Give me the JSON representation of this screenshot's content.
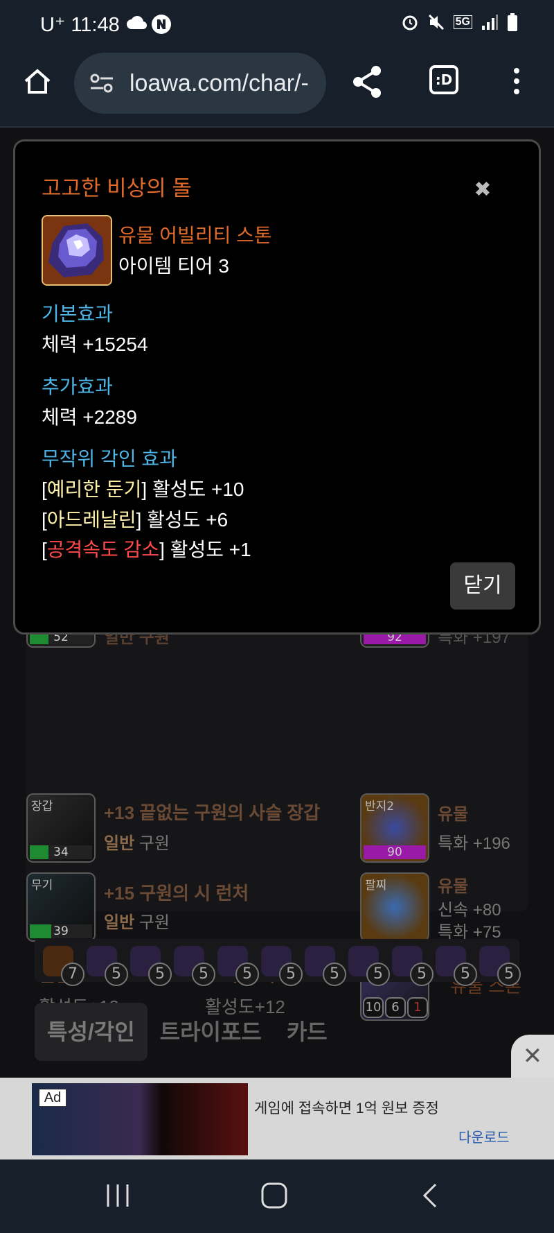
{
  "status": {
    "carrier": "U⁺",
    "time": "11:48",
    "network": "5G"
  },
  "browser": {
    "url": "loawa.com/char/-",
    "tab_label": ":D"
  },
  "background": {
    "items": [
      {
        "slot": "",
        "level": "52",
        "name": "일반 구원",
        "level_color": "#1e8a32"
      },
      {
        "slot": "장갑",
        "level": "34",
        "name": "+13 끝없는 구원의 사슬 장갑",
        "grade": "일반",
        "set": "구원",
        "level_color": "#1e8a32"
      },
      {
        "slot": "무기",
        "level": "39",
        "name": "+15 구원의 시 런처",
        "grade": "일반",
        "set": "구원",
        "level_color": "#1e8a32"
      }
    ],
    "accessories": [
      {
        "slot": "",
        "level": "92",
        "stat": "특화 +197",
        "level_color": "#9a1aa8"
      },
      {
        "slot": "반지2",
        "level": "90",
        "grade": "유물",
        "stat": "특화 +196",
        "level_color": "#9a1aa8"
      },
      {
        "slot": "팔찌",
        "grade": "유물",
        "stat1": "신속 +80",
        "stat2": "특화 +75"
      }
    ],
    "engraving1": {
      "name": "원한",
      "value": "활성도+12"
    },
    "engraving2": {
      "name": "포격 강화",
      "value": "활성도+12"
    },
    "stone": {
      "slot": "스톤",
      "label": "유물 스톤",
      "c1": "10",
      "c2": "6",
      "c3": "1"
    },
    "gems": [
      "7",
      "5",
      "5",
      "5",
      "5",
      "5",
      "5",
      "5",
      "5",
      "5",
      "5"
    ],
    "tabs": [
      "특성/각인",
      "트라이포드",
      "카드"
    ]
  },
  "modal": {
    "title": "고고한 비상의 돌",
    "item_name": "유물 어빌리티 스톤",
    "tier": "아이템 티어 3",
    "base_label": "기본효과",
    "base_value": "체력 +15254",
    "extra_label": "추가효과",
    "extra_value": "체력 +2289",
    "engr_label": "무작위 각인 효과",
    "engravings": [
      {
        "name": "예리한 둔기",
        "value": "활성도 +10",
        "color": "#fff2a8"
      },
      {
        "name": "아드레날린",
        "value": "활성도 +6",
        "color": "#fff2a8"
      },
      {
        "name": "공격속도 감소",
        "value": "활성도 +1",
        "color": "#ff4a4a"
      }
    ],
    "close_label": "닫기"
  },
  "ad": {
    "badge": "Ad",
    "text": "게임에 접속하면 1억 원보 증정",
    "cta": "다운로드"
  }
}
